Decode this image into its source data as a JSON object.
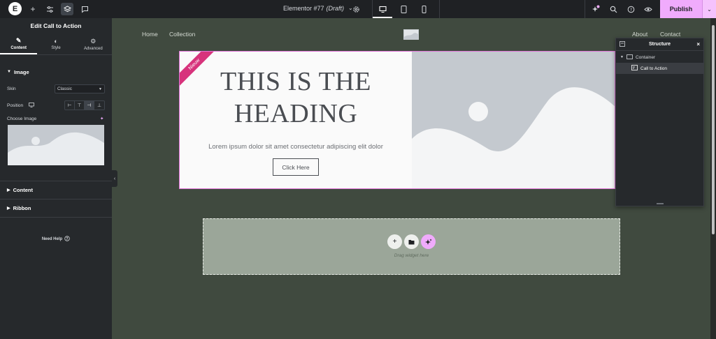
{
  "topbar": {
    "logo": "E",
    "add_icon": "+",
    "page_title": "Elementor #77",
    "page_status": "(Draft)",
    "publish_label": "Publish"
  },
  "panel": {
    "title": "Edit Call to Action",
    "tabs": [
      {
        "label": "Content",
        "icon": "pencil-icon"
      },
      {
        "label": "Style",
        "icon": "half-circle-icon"
      },
      {
        "label": "Advanced",
        "icon": "gear-icon"
      }
    ],
    "image_section": "Image",
    "skin_label": "Skin",
    "skin_value": "Classic",
    "position_label": "Position",
    "choose_image_label": "Choose Image",
    "content_section": "Content",
    "ribbon_section": "Ribbon",
    "need_help": "Need Help"
  },
  "canvas": {
    "nav": {
      "home": "Home",
      "collection": "Collection",
      "about": "About",
      "contact": "Contact"
    },
    "cta": {
      "ribbon": "Nieuw",
      "heading": "THIS IS THE HEADING",
      "description": "Lorem ipsum dolor sit amet consectetur adipiscing elit dolor",
      "button": "Click Here"
    },
    "drop_zone_label": "Drag widget here"
  },
  "structure": {
    "title": "Structure",
    "items": [
      {
        "label": "Container"
      },
      {
        "label": "Call to Action"
      }
    ]
  },
  "colors": {
    "canvas_bg": "#404a3f",
    "panel_bg": "#26292c",
    "accent_pink": "#f0abfc",
    "ribbon": "#d7337c"
  }
}
